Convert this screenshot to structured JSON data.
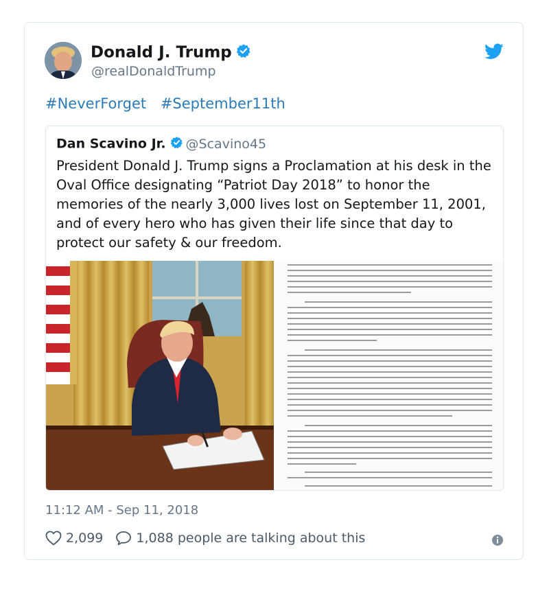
{
  "tweet": {
    "display_name": "Donald J. Trump",
    "handle": "@realDonaldTrump",
    "hashtags": [
      "#NeverForget",
      "#September11th"
    ],
    "timestamp": "11:12 AM - Sep 11, 2018",
    "likes": "2,099",
    "talking": "1,088 people are talking about this"
  },
  "quoted": {
    "display_name": "Dan Scavino Jr.",
    "handle": "@Scavino45",
    "text": "President Donald J. Trump signs a Proclamation at his desk in the Oval Office designating “Patriot Day 2018” to honor the memories of the nearly 3,000 lives lost on September 11, 2001, and of every hero who has given their life since that day to protect our safety & our freedom."
  },
  "colors": {
    "link": "#2b7bb9",
    "verified": "#1da1f2",
    "muted": "#657786"
  },
  "icons": [
    "verified-badge-icon",
    "twitter-bird-icon",
    "heart-icon",
    "comment-icon",
    "info-icon"
  ]
}
